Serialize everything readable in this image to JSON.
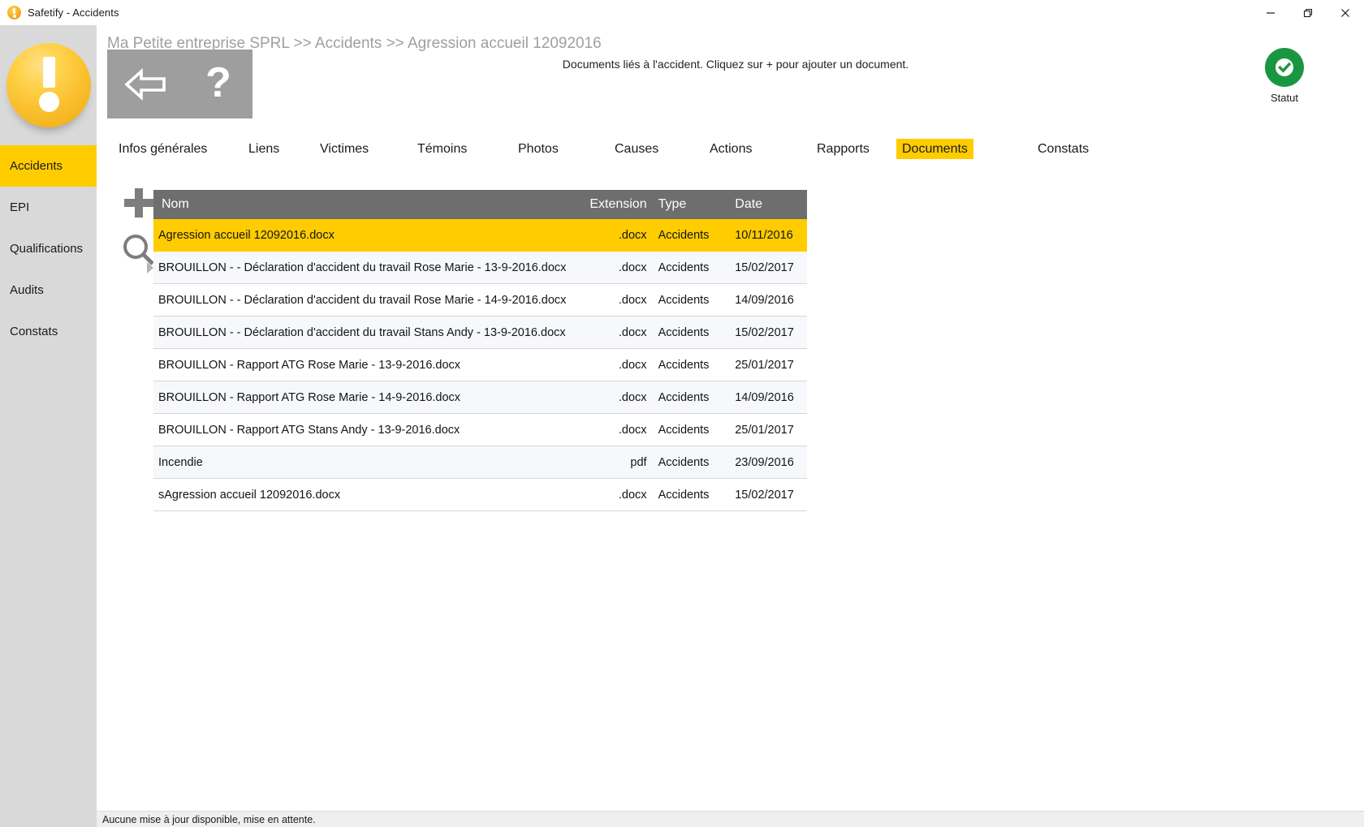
{
  "window": {
    "title": "Safetify - Accidents",
    "logo_icon": "warning-circle-icon",
    "minimize_label": "Minimize",
    "restore_label": "Restore",
    "close_label": "Close"
  },
  "sidebar": {
    "logo_icon": "safetify-logo-icon",
    "items": [
      {
        "label": "Accidents",
        "active": true
      },
      {
        "label": "EPI",
        "active": false
      },
      {
        "label": "Qualifications",
        "active": false
      },
      {
        "label": "Audits",
        "active": false
      },
      {
        "label": "Constats",
        "active": false
      }
    ]
  },
  "header": {
    "breadcrumb": "Ma Petite entreprise SPRL >> Accidents >> Agression accueil 12092016",
    "back_icon": "back-arrow-icon",
    "help_icon": "question-mark-icon",
    "hint": "Documents liés à l'accident. Cliquez sur + pour ajouter un document.",
    "status": {
      "icon": "check-circle-icon",
      "label": "Statut",
      "color": "#1a9641"
    }
  },
  "tabs": [
    {
      "label": "Infos générales",
      "active": false
    },
    {
      "label": "Liens",
      "active": false
    },
    {
      "label": "Victimes",
      "active": false
    },
    {
      "label": "Témoins",
      "active": false
    },
    {
      "label": "Photos",
      "active": false
    },
    {
      "label": "Causes",
      "active": false
    },
    {
      "label": "Actions",
      "active": false
    },
    {
      "label": "Rapports",
      "active": false
    },
    {
      "label": "Documents",
      "active": true
    },
    {
      "label": "Constats",
      "active": false
    }
  ],
  "actions": {
    "add_icon": "plus-icon",
    "search_icon": "magnifier-icon"
  },
  "table": {
    "columns": [
      "Nom",
      "Extension",
      "Type",
      "Date"
    ],
    "rows": [
      {
        "nom": "Agression accueil 12092016.docx",
        "extension": ".docx",
        "type": "Accidents",
        "date": "10/11/2016",
        "selected": true
      },
      {
        "nom": "BROUILLON -  - Déclaration d'accident du travail Rose Marie - 13-9-2016.docx",
        "extension": ".docx",
        "type": "Accidents",
        "date": "15/02/2017",
        "selected": false
      },
      {
        "nom": "BROUILLON -  - Déclaration d'accident du travail Rose Marie - 14-9-2016.docx",
        "extension": ".docx",
        "type": "Accidents",
        "date": "14/09/2016",
        "selected": false
      },
      {
        "nom": "BROUILLON -  - Déclaration d'accident du travail Stans Andy - 13-9-2016.docx",
        "extension": ".docx",
        "type": "Accidents",
        "date": "15/02/2017",
        "selected": false
      },
      {
        "nom": "BROUILLON - Rapport ATG Rose Marie - 13-9-2016.docx",
        "extension": ".docx",
        "type": "Accidents",
        "date": "25/01/2017",
        "selected": false
      },
      {
        "nom": "BROUILLON - Rapport ATG Rose Marie - 14-9-2016.docx",
        "extension": ".docx",
        "type": "Accidents",
        "date": "14/09/2016",
        "selected": false
      },
      {
        "nom": "BROUILLON - Rapport ATG Stans Andy - 13-9-2016.docx",
        "extension": ".docx",
        "type": "Accidents",
        "date": "25/01/2017",
        "selected": false
      },
      {
        "nom": "Incendie",
        "extension": "pdf",
        "type": "Accidents",
        "date": "23/09/2016",
        "selected": false
      },
      {
        "nom": "sAgression accueil 12092016.docx",
        "extension": ".docx",
        "type": "Accidents",
        "date": "15/02/2017",
        "selected": false
      }
    ]
  },
  "statusbar": {
    "message": "Aucune mise à jour disponible, mise en attente."
  },
  "colors": {
    "accent_yellow": "#ffcc00",
    "sidebar_gray": "#d9d9d9",
    "header_gray": "#6e6e6e",
    "status_green": "#1a9641"
  }
}
